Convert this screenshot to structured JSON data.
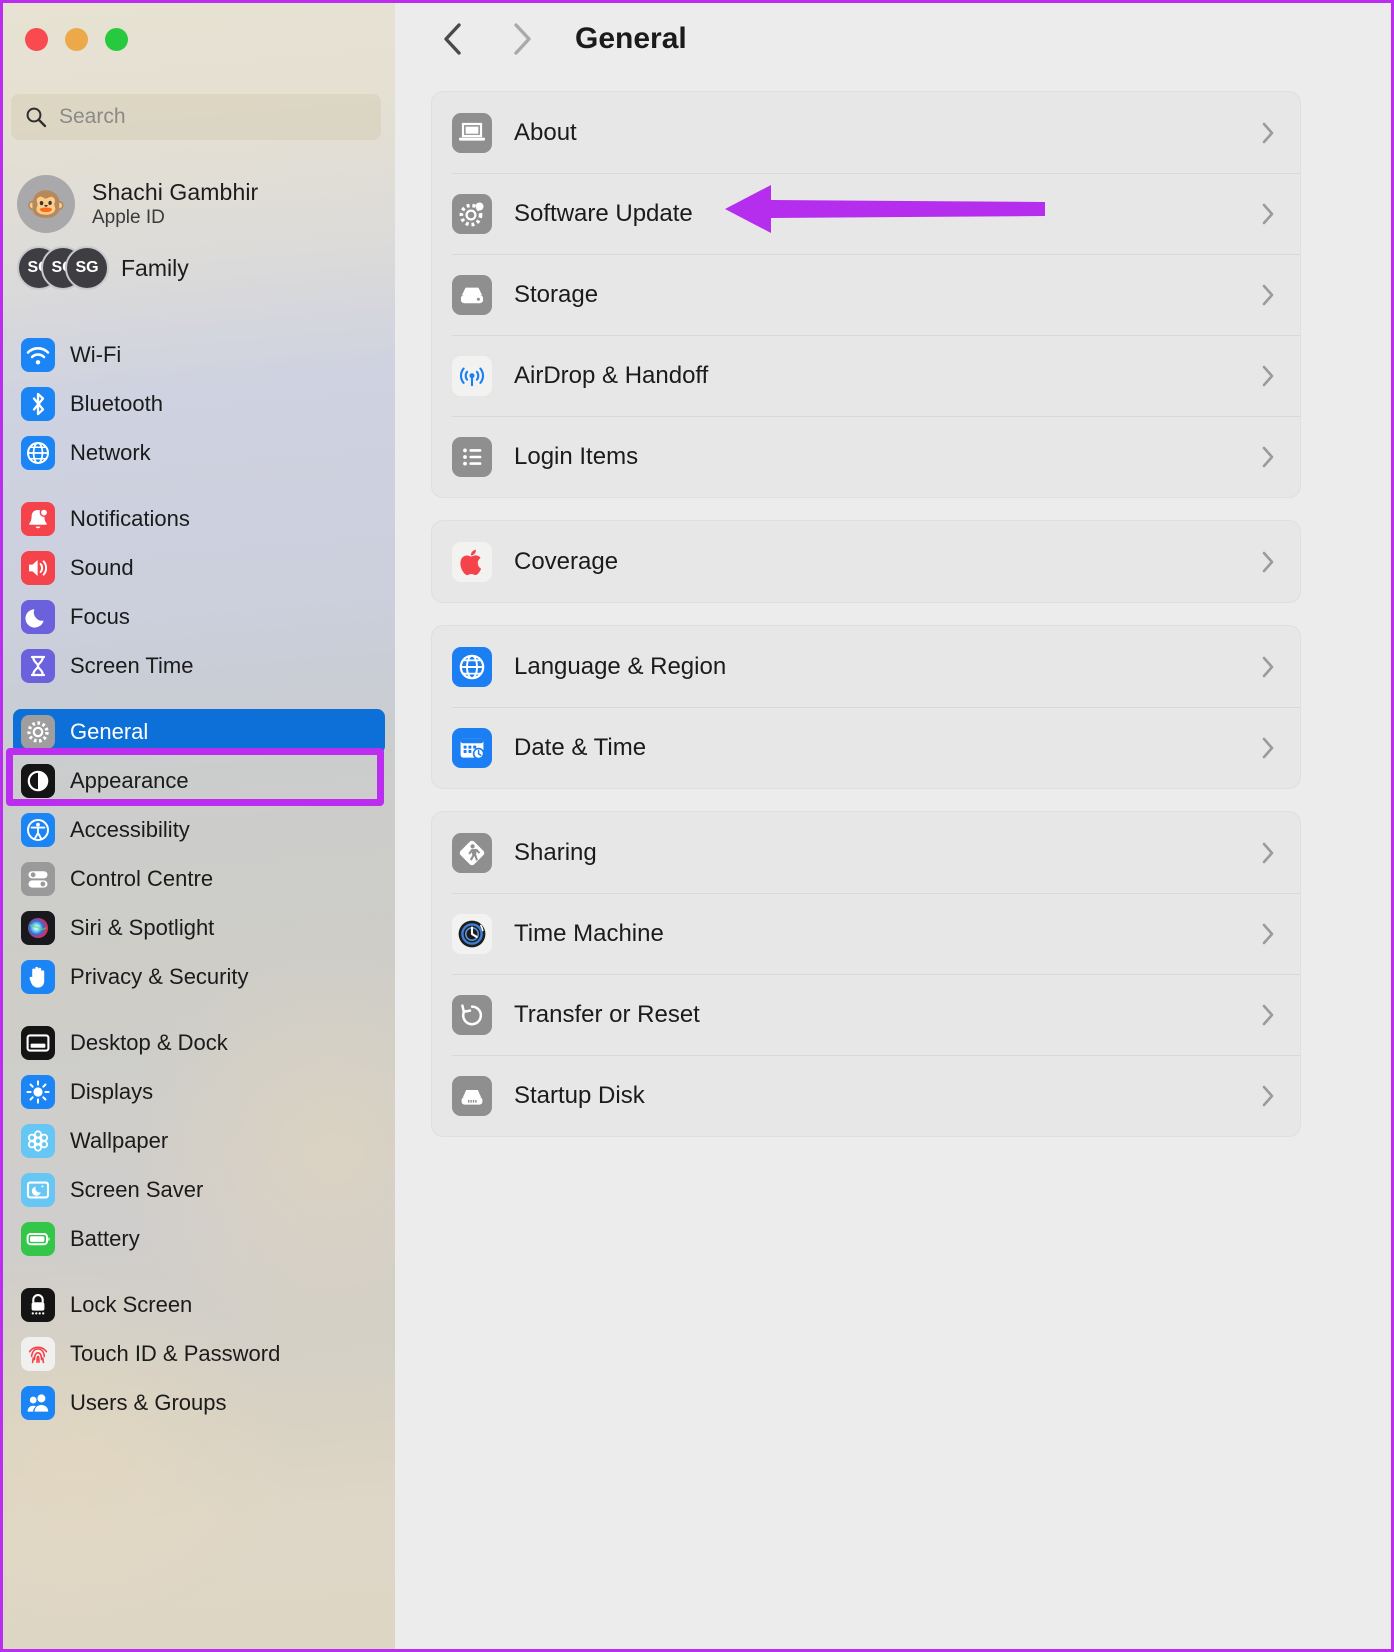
{
  "window": {
    "traffic_lights": [
      "close",
      "minimize",
      "zoom"
    ],
    "annotation_color": "#bb2ef0",
    "selection_color": "#0d6fd8"
  },
  "sidebar": {
    "search": {
      "placeholder": "Search",
      "value": "",
      "icon": "search-icon"
    },
    "account": {
      "name": "Shachi Gambhir",
      "subtitle": "Apple ID",
      "avatar_glyph": "🐵"
    },
    "family": {
      "label": "Family",
      "initials": [
        "SG",
        "SG",
        "SG"
      ]
    },
    "groups": [
      {
        "items": [
          {
            "label": "Wi-Fi",
            "icon": "wifi-icon"
          },
          {
            "label": "Bluetooth",
            "icon": "bluetooth-icon"
          },
          {
            "label": "Network",
            "icon": "network-globe-icon"
          }
        ]
      },
      {
        "items": [
          {
            "label": "Notifications",
            "icon": "bell-icon"
          },
          {
            "label": "Sound",
            "icon": "speaker-icon"
          },
          {
            "label": "Focus",
            "icon": "moon-icon"
          },
          {
            "label": "Screen Time",
            "icon": "hourglass-icon"
          }
        ]
      },
      {
        "items": [
          {
            "label": "General",
            "icon": "gear-icon",
            "selected": true,
            "annotated": true
          },
          {
            "label": "Appearance",
            "icon": "appearance-contrast-icon"
          },
          {
            "label": "Accessibility",
            "icon": "accessibility-icon"
          },
          {
            "label": "Control Centre",
            "icon": "control-centre-toggles-icon"
          },
          {
            "label": "Siri & Spotlight",
            "icon": "siri-orb-icon"
          },
          {
            "label": "Privacy & Security",
            "icon": "hand-privacy-icon"
          }
        ]
      },
      {
        "items": [
          {
            "label": "Desktop & Dock",
            "icon": "desktop-dock-icon"
          },
          {
            "label": "Displays",
            "icon": "brightness-sun-icon"
          },
          {
            "label": "Wallpaper",
            "icon": "wallpaper-flower-icon"
          },
          {
            "label": "Screen Saver",
            "icon": "screen-saver-icon"
          },
          {
            "label": "Battery",
            "icon": "battery-icon"
          }
        ]
      },
      {
        "items": [
          {
            "label": "Lock Screen",
            "icon": "lock-icon"
          },
          {
            "label": "Touch ID & Password",
            "icon": "fingerprint-icon"
          },
          {
            "label": "Users & Groups",
            "icon": "users-group-icon"
          }
        ]
      }
    ]
  },
  "main": {
    "header": {
      "back_icon": "chevron-left-icon",
      "forward_icon": "chevron-right-icon",
      "title": "General"
    },
    "cards": [
      {
        "rows": [
          {
            "label": "About",
            "icon": "about-laptop-icon"
          },
          {
            "label": "Software Update",
            "icon": "software-update-gear-icon",
            "annotated": true
          },
          {
            "label": "Storage",
            "icon": "storage-drive-icon"
          },
          {
            "label": "AirDrop & Handoff",
            "icon": "airdrop-icon"
          },
          {
            "label": "Login Items",
            "icon": "login-items-list-icon"
          }
        ]
      },
      {
        "rows": [
          {
            "label": "Coverage",
            "icon": "apple-logo-icon"
          }
        ]
      },
      {
        "rows": [
          {
            "label": "Language & Region",
            "icon": "globe-icon"
          },
          {
            "label": "Date & Time",
            "icon": "calendar-clock-icon"
          }
        ]
      },
      {
        "rows": [
          {
            "label": "Sharing",
            "icon": "sharing-walk-icon"
          },
          {
            "label": "Time Machine",
            "icon": "time-machine-icon"
          },
          {
            "label": "Transfer or Reset",
            "icon": "reset-arrow-icon"
          },
          {
            "label": "Startup Disk",
            "icon": "startup-disk-icon"
          }
        ]
      }
    ],
    "annotation": {
      "type": "arrow",
      "direction": "left",
      "points_to": "Software Update",
      "color": "#bb2ef0"
    }
  }
}
